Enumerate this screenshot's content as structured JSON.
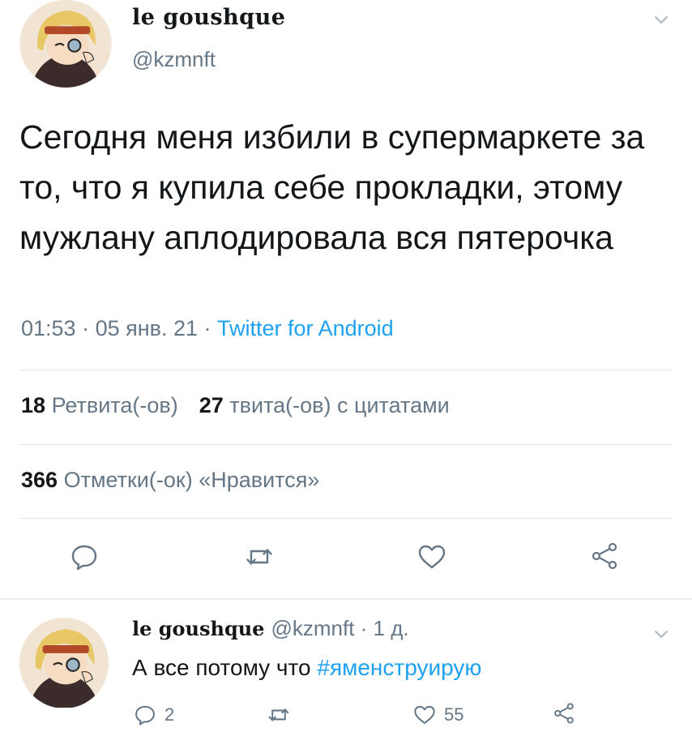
{
  "tweet": {
    "display_name": "le goushque",
    "handle": "@kzmnft",
    "text": "Сегодня меня избили в супермаркете за то, что я купила себе прокладки, этому мужлану аплодировала вся пятерочка",
    "time": "01:53",
    "date": "05 янв. 21",
    "source": "Twitter for Android",
    "separator": " · ",
    "retweets_count": "18",
    "retweets_label": "Ретвита(-ов)",
    "quotes_count": "27",
    "quotes_label": "твита(-ов) с цитатами",
    "likes_count": "366",
    "likes_label": "Отметки(-ок) «Нравится»"
  },
  "reply": {
    "display_name": "le goushque",
    "handle_time": "@kzmnft · 1 д.",
    "text": "А все потому что ",
    "hashtag": "#яменструирую",
    "replies_count": "2",
    "likes_count": "55"
  },
  "icons": {
    "reply": "reply-icon",
    "retweet": "retweet-icon",
    "like": "heart-icon",
    "share": "share-icon",
    "caret": "chevron-down-icon"
  },
  "colors": {
    "text": "#14171a",
    "secondary": "#657786",
    "link": "#1da1f2",
    "divider": "#e1e8ed"
  }
}
